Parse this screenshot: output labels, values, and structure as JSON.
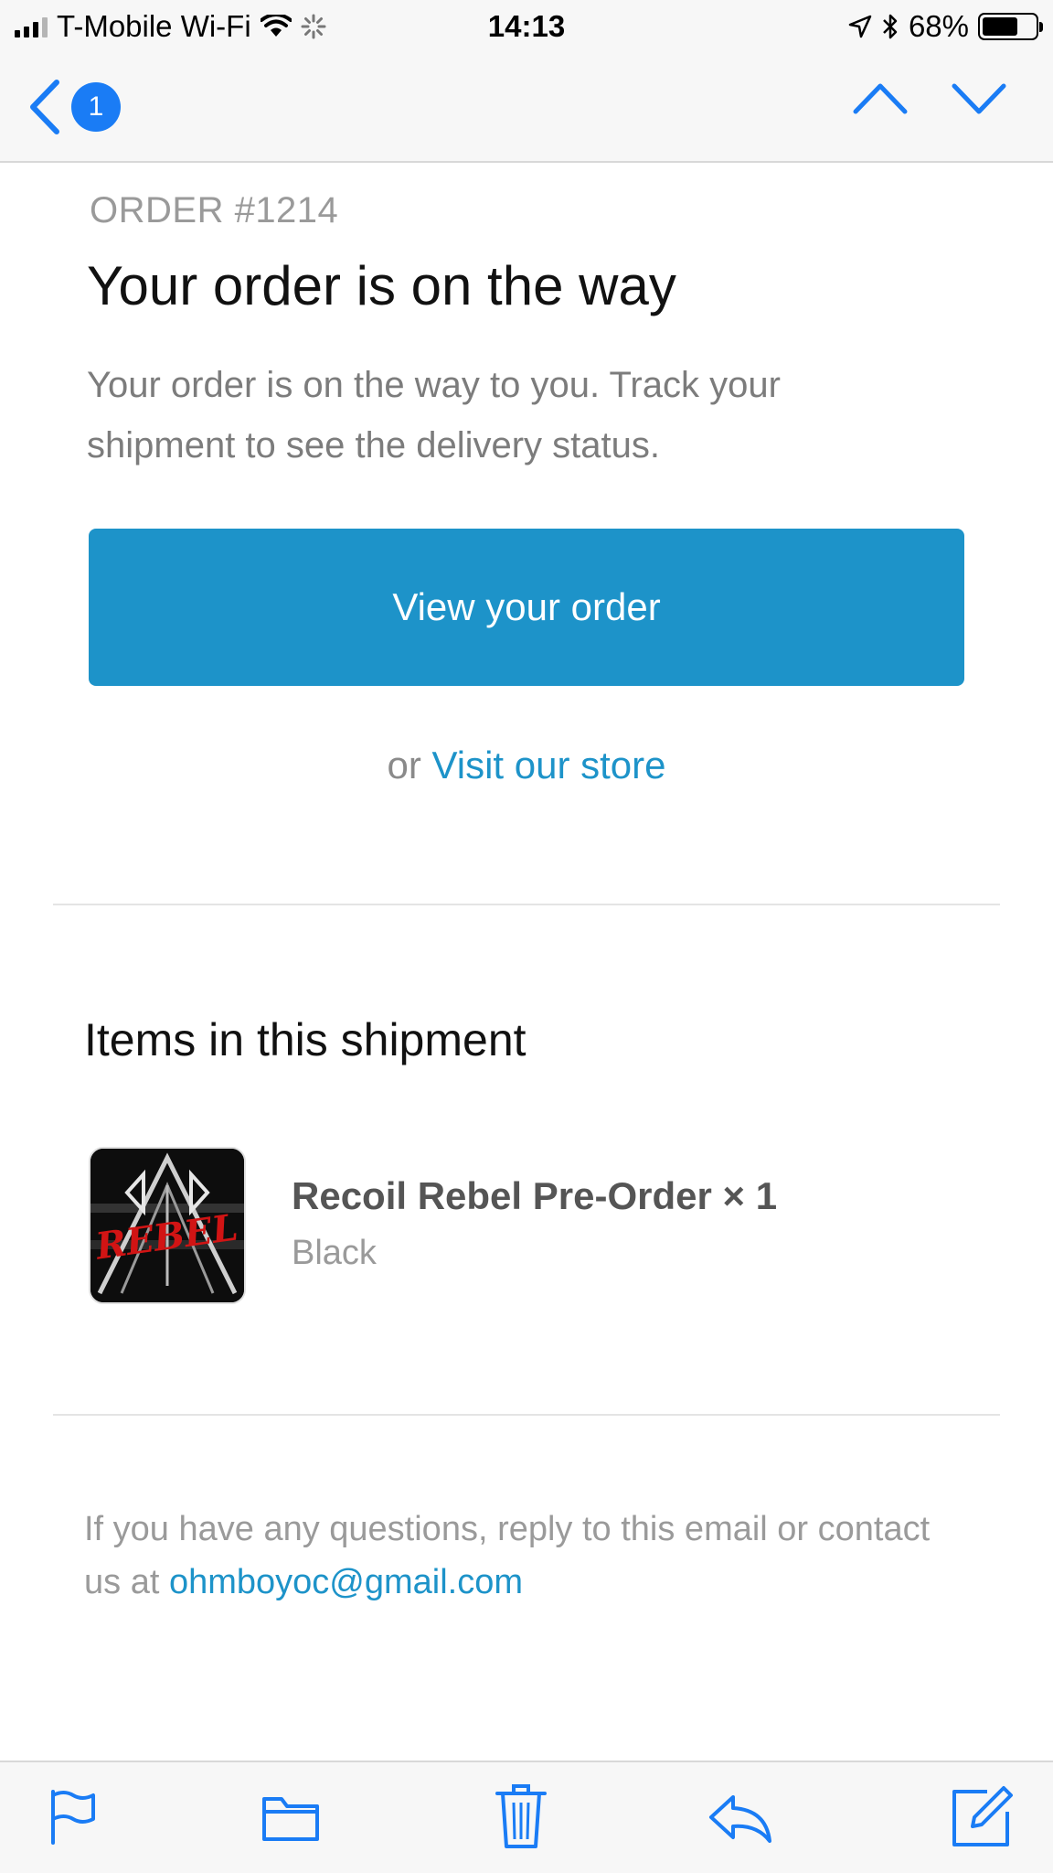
{
  "status_bar": {
    "carrier": "T-Mobile Wi-Fi",
    "time": "14:13",
    "battery_percent": "68%",
    "battery_level": 0.68
  },
  "nav": {
    "unread_count": "1"
  },
  "email": {
    "order_number": "ORDER #1214",
    "headline": "Your order is on the way",
    "intro": "Your order is on the way to you. Track your shipment to see the delivery status.",
    "cta_label": "View your order",
    "or_text": "or",
    "store_link": "Visit our store",
    "section_title": "Items in this shipment",
    "items": [
      {
        "name": "Recoil Rebel Pre-Order × 1",
        "variant": "Black",
        "image_text": "REBEL"
      }
    ],
    "footer_text": "If you have any questions, reply to this email or contact us at",
    "footer_email": "ohmboyoc@gmail.com"
  },
  "colors": {
    "accent": "#1d93c9",
    "ios_blue": "#1a7cf5",
    "muted_text": "#9a9a9a"
  },
  "toolbar_icons": [
    "flag-icon",
    "folder-icon",
    "trash-icon",
    "reply-icon",
    "compose-icon"
  ]
}
